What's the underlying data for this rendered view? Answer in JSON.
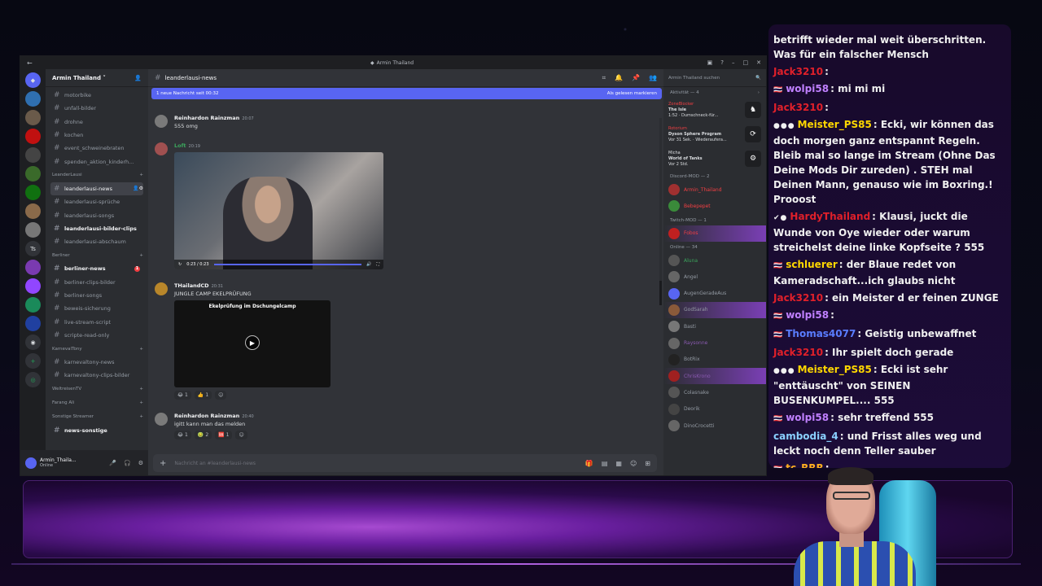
{
  "discord": {
    "window_title": "Armin Thailand",
    "guild_name": "Armin Thailand",
    "channels_top": [
      "motorbike",
      "unfall-bilder",
      "drohne",
      "kochen",
      "event_schweinebraten",
      "spenden_aktion_kinderh..."
    ],
    "categories": {
      "leander": "LeanderLausi",
      "berliner": "Berliner",
      "karneval": "KarnevalTony",
      "weltreisen": "WeltreisenTV",
      "farang": "Farang Ali",
      "sonstige": "Sonstige Streamer"
    },
    "leander_channels": [
      "leanderlausi-news",
      "leanderlausi-sprüche",
      "leanderlausi-songs",
      "leanderlausi-bilder-clips",
      "leanderlausi-abschaum"
    ],
    "berliner_channels": [
      "berliner-news",
      "berliner-clips-bilder",
      "berliner-songs",
      "beweis-sicherung",
      "live-stream-script",
      "scripte-read-only"
    ],
    "karneval_channels": [
      "karnevaltony-news",
      "karnevaltony-clips-bilder"
    ],
    "sonstige_channels": [
      "news-sonstige"
    ],
    "berliner_badge": "1",
    "current_channel": "leanderlausi-news",
    "new_bar": {
      "left": "1 neue Nachricht seit 00:32",
      "right": "Als gelesen markieren"
    },
    "messages": [
      {
        "author": "Reinhardon Rainzman",
        "time": "20:07",
        "text": "555 omg"
      },
      {
        "author": "Loft",
        "time": "20:19",
        "text": "",
        "video_time": "0:23 / 0:23"
      },
      {
        "author": "THailandCD",
        "time": "20:31",
        "text": "JUNGLE CAMP EKELPRÜFUNG",
        "video_caption": "Ekelprüfung im Dschungelcamp",
        "reacts": [
          "1",
          "1"
        ]
      },
      {
        "author": "Reinhardon Rainzman",
        "time": "20:40",
        "text": "igitt kann man das melden",
        "reacts": [
          "1",
          "2",
          "1"
        ]
      }
    ],
    "composer_placeholder": "Nachricht an #leanderlausi-news",
    "user": {
      "name": "Armin_Thaila...",
      "status": "Online"
    },
    "members": {
      "search": "Armin Thailand suchen",
      "activity_header": "Aktivität — 4",
      "activities": [
        {
          "name": "ZoneBlocker",
          "game": "The Isle",
          "detail": "1:52 · Dumschneck-für..."
        },
        {
          "name": "Rotorium",
          "game": "Dyson Sphere Program",
          "detail": "Vor 31 Sek. · Wiederaufera..."
        },
        {
          "name": "Micha",
          "game": "World of Tanks",
          "detail": "Vor 2 Std."
        }
      ],
      "mod_header": "Discord-MOD — 2",
      "mods": [
        "Armin_Thailand",
        "Bebepepet"
      ],
      "twitch_header": "Twitch-MOD — 1",
      "twitch_mods": [
        "Fobos"
      ],
      "online_header": "Online — 34",
      "online": [
        "Aluna",
        "Angel",
        "AugenGeradeAus",
        "GodSarah",
        "Basti",
        "Raysonne",
        "BotRix",
        "ChrisKrono",
        "Colasnake",
        "Deorik",
        "DinoCrocetti"
      ]
    }
  },
  "twitch_chat": [
    {
      "user": "",
      "color": "#f0f0f0",
      "text": "betrifft wieder mal weit überschritten. Was für ein falscher Mensch",
      "badges": ""
    },
    {
      "user": "Jack3210",
      "color": "#e0202a",
      "text": "",
      "badges": ""
    },
    {
      "user": "wolpi58",
      "color": "#c080ff",
      "text": "mi mi mi",
      "badges": "🇹🇭"
    },
    {
      "user": "Jack3210",
      "color": "#e0202a",
      "text": "",
      "badges": ""
    },
    {
      "user": "Meister_PS85",
      "color": "#ffd700",
      "text": "Ecki, wir können das doch morgen ganz entspannt Regeln. Bleib mal so lange im Stream (Ohne Das Deine Mods Dir zureden) . STEH mal Deinen Mann, genauso wie im Boxring.! Prooost",
      "badges": "●●●"
    },
    {
      "user": "HardyThailand",
      "color": "#e0202a",
      "text": "Klausi, juckt die Wunde von Oye wieder oder warum streichelst deine linke Kopfseite ? 555",
      "badges": "✔●"
    },
    {
      "user": "schluerer",
      "color": "#ffd700",
      "text": "der Blaue redet von Kameradschaft...ich glaubs nicht",
      "badges": "🇹🇭"
    },
    {
      "user": "Jack3210",
      "color": "#e0202a",
      "text": "ein Meister d er feinen ZUNGE",
      "badges": ""
    },
    {
      "user": "wolpi58",
      "color": "#c080ff",
      "text": "",
      "badges": "🇹🇭"
    },
    {
      "user": "Thomas4077",
      "color": "#5a7dff",
      "text": "Geistig unbewaffnet",
      "badges": "🇹🇭"
    },
    {
      "user": "Jack3210",
      "color": "#e0202a",
      "text": "Ihr spielt doch gerade",
      "badges": ""
    },
    {
      "user": "Meister_PS85",
      "color": "#ffd700",
      "text": "Ecki ist sehr \"enttäuscht\" von SEINEN BUSENKUMPEL.... 555",
      "badges": "●●●"
    },
    {
      "user": "wolpi58",
      "color": "#c080ff",
      "text": "sehr treffend 555",
      "badges": "🇹🇭"
    },
    {
      "user": "cambodia_4",
      "color": "#8ad0ff",
      "text": "und Frisst alles weg und leckt noch denn Teller sauber",
      "badges": ""
    },
    {
      "user": "tc_RRR",
      "color": "#ffb020",
      "text": "",
      "badges": "🇹🇭"
    }
  ]
}
